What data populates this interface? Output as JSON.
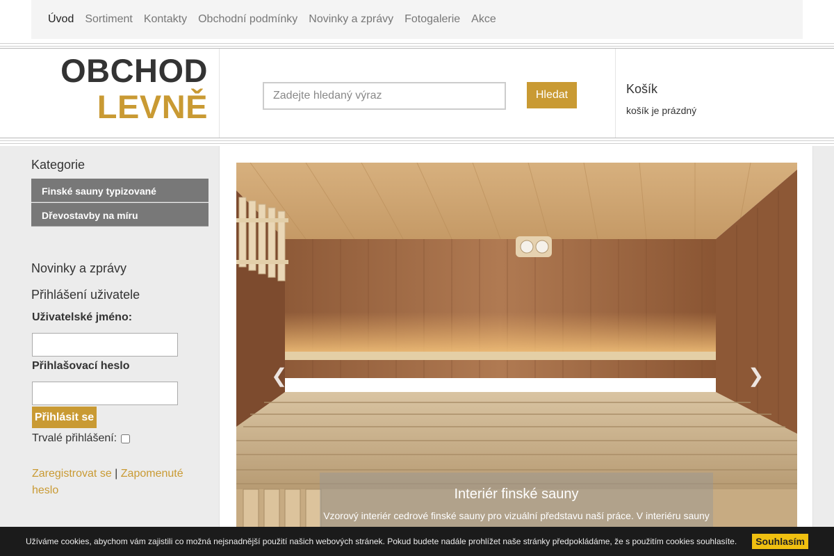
{
  "nav": {
    "items": [
      "Úvod",
      "Sortiment",
      "Kontakty",
      "Obchodní podmínky",
      "Novinky a zprávy",
      "Fotogalerie",
      "Akce"
    ]
  },
  "logo": {
    "line1": "OBCHOD",
    "line2": "LEVNĚ"
  },
  "search": {
    "placeholder": "Zadejte hledaný výraz",
    "button": "Hledat"
  },
  "cart": {
    "title": "Košík",
    "status": "košík je prázdný"
  },
  "sidebar": {
    "categories_title": "Kategorie",
    "categories": [
      "Finské sauny typizované",
      "Dřevostavby na míru"
    ],
    "news_title": "Novinky a zprávy",
    "login_title": "Přihlášení uživatele",
    "username_label": "Uživatelské jméno:",
    "password_label": "Přihlašovací heslo",
    "login_button": "Přihlásit se",
    "remember_label": "Trvalé přihlášení:",
    "register_link": "Zaregistrovat se",
    "separator": "|",
    "forgot_link": "Zapomenuté heslo"
  },
  "carousel": {
    "caption_title": "Interiér finské sauny",
    "caption_text": "Vzorový interiér cedrové finské sauny pro vizuální představu naší práce. V interiéru sauny",
    "prev_icon": "chevron-left-icon",
    "next_icon": "chevron-right-icon"
  },
  "cookie": {
    "text": "Užíváme cookies, abychom vám zajistili co možná nejsnadnější použití našich webových stránek. Pokud budete nadále prohlížet naše stránky předpokládáme, že s použitím cookies souhlasíte.",
    "button": "Souhlasím"
  },
  "colors": {
    "accent": "#c99a33",
    "category_bg": "#787878",
    "cookie_bg": "#1b1b1b",
    "cookie_button": "#f0c010"
  }
}
